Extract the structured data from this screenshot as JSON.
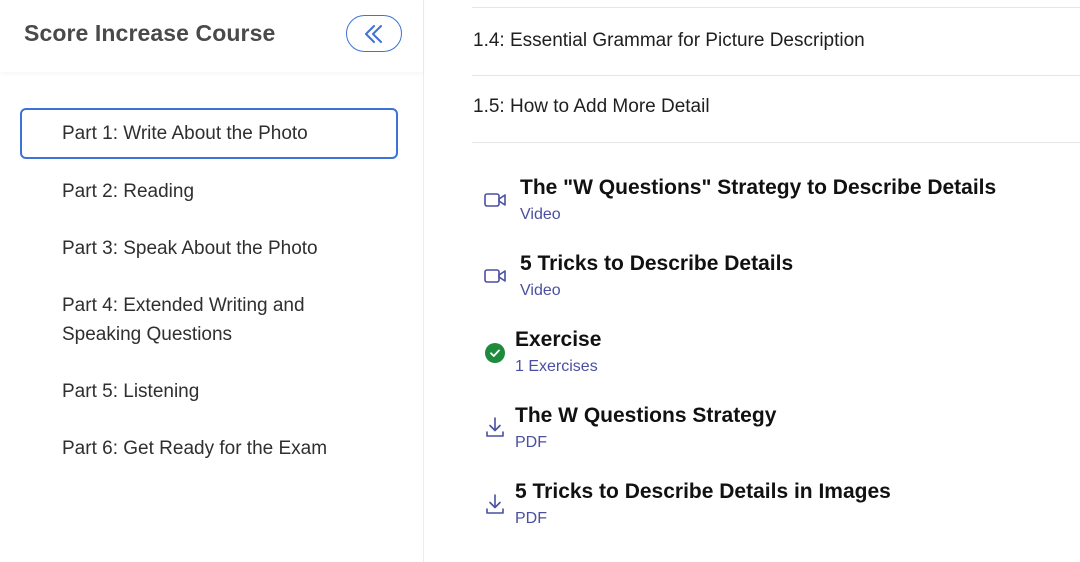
{
  "sidebar": {
    "course_title": "Score Increase Course",
    "collapse_icon": "double-chevron-left-icon",
    "items": [
      {
        "label": "Part 1: Write About the Photo",
        "active": true
      },
      {
        "label": "Part 2: Reading"
      },
      {
        "label": "Part 3: Speak About the Photo"
      },
      {
        "label": "Part 4: Extended Writing and Speaking Questions"
      },
      {
        "label": "Part 5: Listening"
      },
      {
        "label": "Part 6: Get Ready for the Exam"
      }
    ]
  },
  "main": {
    "lessons": [
      {
        "label": "1.4: Essential Grammar for Picture Description"
      },
      {
        "label": "1.5: How to Add More Detail"
      }
    ],
    "content_items": [
      {
        "title": "The \"W Questions\" Strategy to Describe Details",
        "subtitle": "Video",
        "icon": "video-camera-icon"
      },
      {
        "title": "5 Tricks to Describe Details",
        "subtitle": "Video",
        "icon": "video-camera-icon"
      },
      {
        "title": "Exercise",
        "subtitle": "1 Exercises",
        "icon": "check-circle-icon"
      },
      {
        "title": "The W Questions Strategy",
        "subtitle": "PDF",
        "icon": "download-icon"
      },
      {
        "title": "5 Tricks to Describe Details in Images",
        "subtitle": "PDF",
        "icon": "download-icon"
      }
    ]
  },
  "colors": {
    "accent": "#3d73d6",
    "subtitle": "#4a4fa0",
    "success": "#1e8a3c"
  }
}
